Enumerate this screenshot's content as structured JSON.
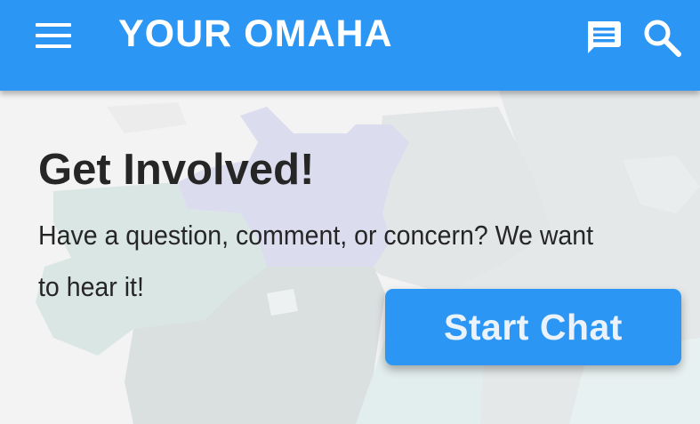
{
  "app_bar": {
    "title": "YOUR OMAHA",
    "menu_icon": "hamburger-menu-icon",
    "chat_icon": "chat-message-icon",
    "search_icon": "search-icon",
    "background_color": "#2b96f3"
  },
  "main": {
    "heading": "Get Involved!",
    "description": "Have a question, comment, or concern? We want to hear it!",
    "cta_label": "Start Chat",
    "cta_color": "#2b96f3"
  },
  "background": {
    "type": "faded city district map"
  }
}
